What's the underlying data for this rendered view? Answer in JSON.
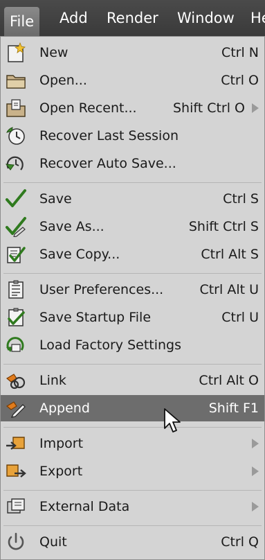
{
  "menubar": {
    "file": "File",
    "add": "Add",
    "render": "Render",
    "window": "Window",
    "help": "He"
  },
  "menu": {
    "items": [
      {
        "label": "New",
        "shortcut": "Ctrl N"
      },
      {
        "label": "Open...",
        "shortcut": "Ctrl O"
      },
      {
        "label": "Open Recent...",
        "shortcut": "Shift Ctrl O"
      },
      {
        "label": "Recover Last Session",
        "shortcut": ""
      },
      {
        "label": "Recover Auto Save...",
        "shortcut": ""
      },
      {
        "label": "Save",
        "shortcut": "Ctrl S"
      },
      {
        "label": "Save As...",
        "shortcut": "Shift Ctrl S"
      },
      {
        "label": "Save Copy...",
        "shortcut": "Ctrl Alt S"
      },
      {
        "label": "User Preferences...",
        "shortcut": "Ctrl Alt U"
      },
      {
        "label": "Save Startup File",
        "shortcut": "Ctrl U"
      },
      {
        "label": "Load Factory Settings",
        "shortcut": ""
      },
      {
        "label": "Link",
        "shortcut": "Ctrl Alt O"
      },
      {
        "label": "Append",
        "shortcut": "Shift F1"
      },
      {
        "label": "Import",
        "shortcut": ""
      },
      {
        "label": "Export",
        "shortcut": ""
      },
      {
        "label": "External Data",
        "shortcut": ""
      },
      {
        "label": "Quit",
        "shortcut": "Ctrl Q"
      }
    ]
  }
}
